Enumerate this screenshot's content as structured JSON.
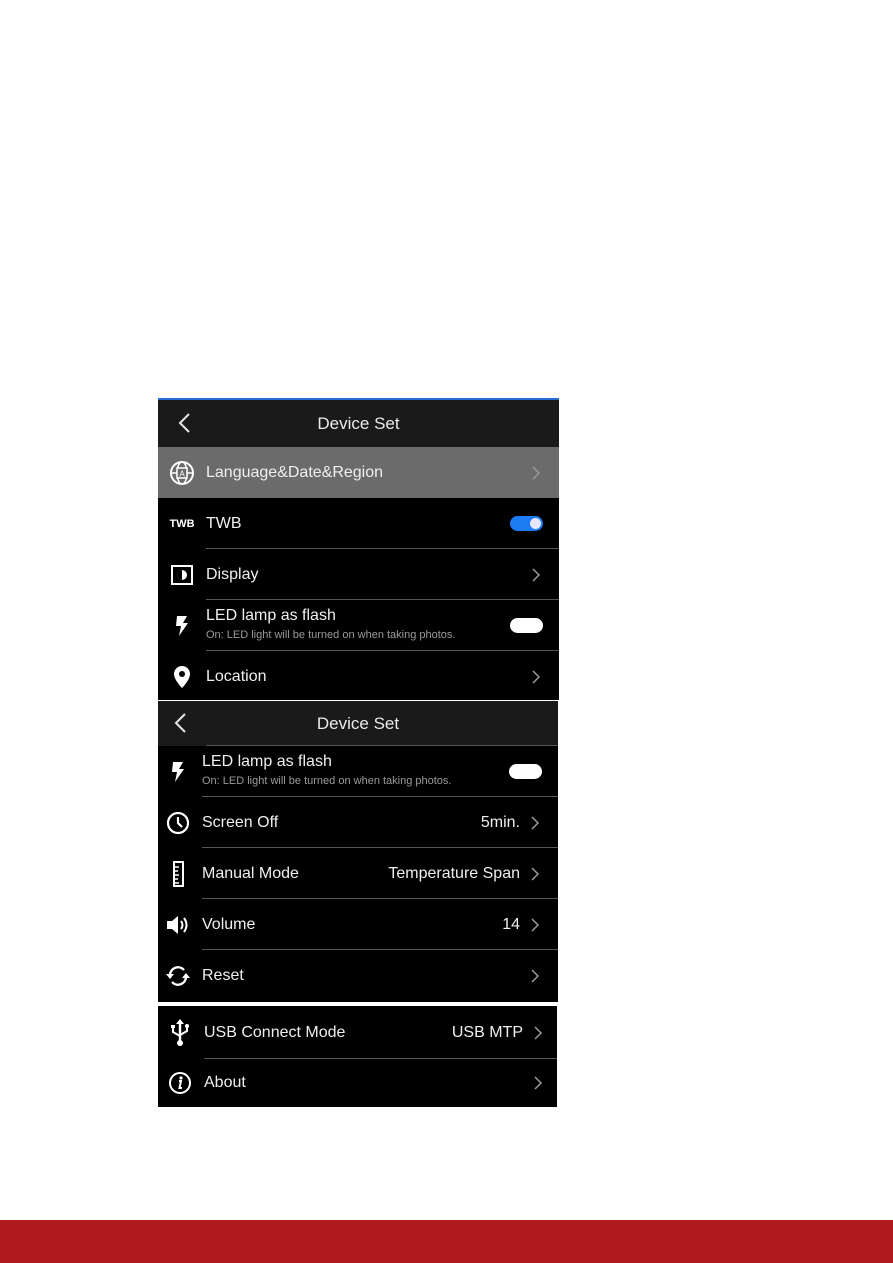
{
  "colors": {
    "footer_bar": "#b01a1e",
    "toggle_on": "#1d7bf3",
    "header_accent": "#2b6cd6"
  },
  "screens": [
    {
      "header": {
        "title": "Device Set",
        "back_icon": "chevron-left-icon"
      },
      "items": [
        {
          "icon": "globe-language-icon",
          "label": "Language&Date&Region",
          "control": "chevron",
          "highlighted": true
        },
        {
          "icon": "twb-icon",
          "icon_text": "TWB",
          "label": "TWB",
          "control": "toggle",
          "toggle_on": true
        },
        {
          "icon": "display-icon",
          "label": "Display",
          "control": "chevron"
        },
        {
          "icon": "flash-icon",
          "label": "LED lamp as flash",
          "sublabel": "On: LED light will be turned on when taking photos.",
          "control": "toggle",
          "toggle_on": false
        },
        {
          "icon": "location-pin-icon",
          "label": "Location",
          "control": "chevron"
        }
      ]
    },
    {
      "header": {
        "title": "Device Set",
        "back_icon": "chevron-left-icon"
      },
      "items": [
        {
          "icon": "flash-icon",
          "label": "LED lamp as flash",
          "sublabel": "On: LED light will be turned on when taking photos.",
          "control": "toggle",
          "toggle_on": false
        },
        {
          "icon": "clock-icon",
          "label": "Screen Off",
          "value": "5min.",
          "control": "chevron"
        },
        {
          "icon": "ruler-icon",
          "label": "Manual Mode",
          "value": "Temperature Span",
          "control": "chevron"
        },
        {
          "icon": "volume-icon",
          "label": "Volume",
          "value": "14",
          "control": "chevron"
        },
        {
          "icon": "reset-icon",
          "label": "Reset",
          "control": "chevron"
        }
      ]
    },
    {
      "items": [
        {
          "icon": "usb-icon",
          "label": "USB Connect Mode",
          "value": "USB MTP",
          "control": "chevron"
        },
        {
          "icon": "info-icon",
          "label": "About",
          "control": "chevron"
        }
      ]
    }
  ]
}
